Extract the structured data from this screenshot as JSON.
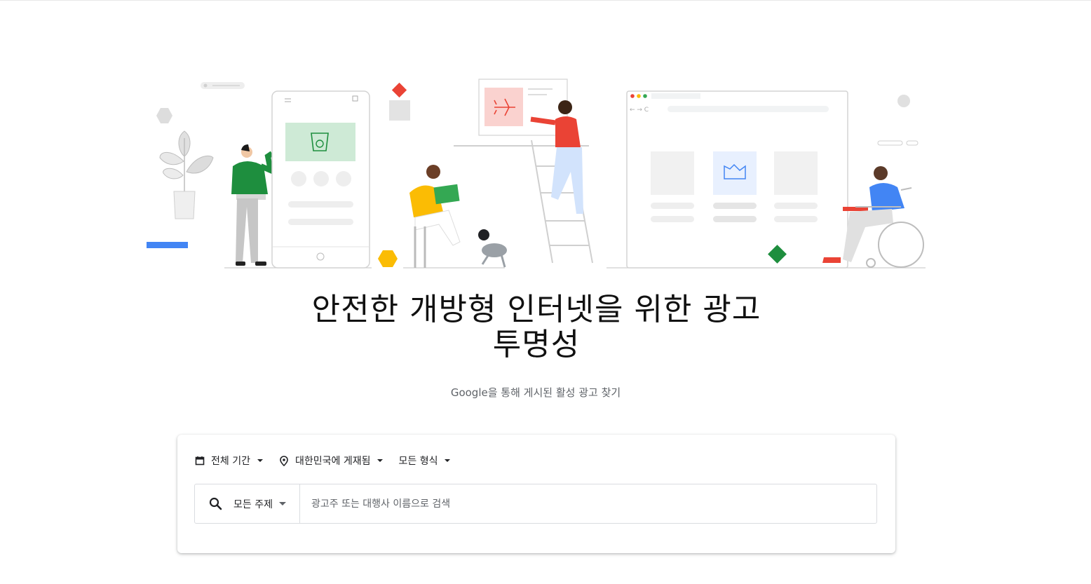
{
  "hero": {
    "title": "안전한 개방형 인터넷을 위한 광고 투명성",
    "subtitle": "Google을 통해 게시된 활성 광고 찾기"
  },
  "filters": [
    {
      "label": "전체 기간",
      "icon": "calendar-icon"
    },
    {
      "label": "대한민국에 게재됨",
      "icon": "location-pin-icon"
    },
    {
      "label": "모든 형식",
      "icon": ""
    }
  ],
  "search": {
    "topic_label": "모든 주제",
    "input_value": "",
    "placeholder": "광고주 또는 대행사 이름으로 검색",
    "icon": "search-icon"
  },
  "colors": {
    "google_blue": "#4285f4",
    "google_red": "#ea4335",
    "google_yellow": "#fbbc04",
    "google_green": "#1e8e3e",
    "subtle_text": "#5f6368"
  }
}
